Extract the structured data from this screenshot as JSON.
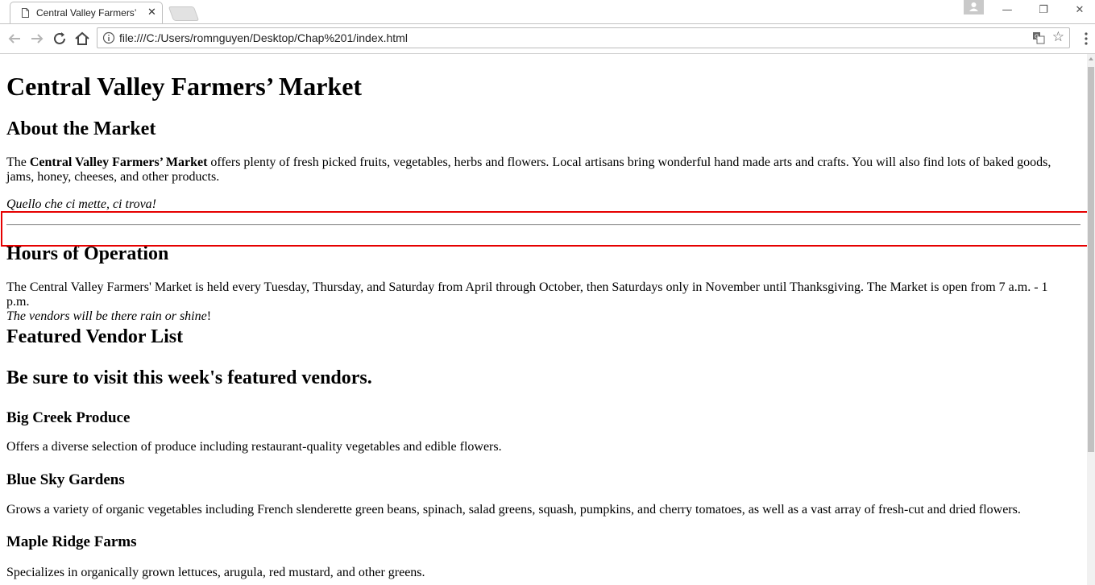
{
  "browser": {
    "tab_title": "Central Valley Farmers’ M",
    "url": "file:///C:/Users/romnguyen/Desktop/Chap%201/index.html",
    "close_glyph": "✕",
    "minimize_glyph": "—",
    "restore_glyph": "❐",
    "window_close_glyph": "✕"
  },
  "page": {
    "title": "Central Valley Farmers’ Market",
    "about": {
      "heading": "About the Market",
      "para_prefix": "The ",
      "para_bold": "Central Valley Farmers’ Market",
      "para_rest_line1": " offers plenty of fresh picked fruits, vegetables, herbs and flowers. Local artisans bring wonderful hand made arts and crafts. You will also find lots of baked goods,",
      "para_line2": "jams, honey, cheeses, and other products.",
      "motto": "Quello che ci mette, ci trova!"
    },
    "hours": {
      "heading": "Hours of Operation",
      "para_line1": "The Central Valley Farmers' Market is held every Tuesday, Thursday, and Saturday from April through October, then Saturdays only in November until Thanksgiving. The Market is open from 7 a.m. - 1 p.m.",
      "para_italic": "The vendors will be there rain or shine",
      "para_end": "!"
    },
    "vendors": {
      "heading": "Featured Vendor List",
      "subheading": "Be sure to visit this week's featured vendors.",
      "items": [
        {
          "name": "Big Creek Produce",
          "desc": "Offers a diverse selection of produce including restaurant-quality vegetables and edible flowers."
        },
        {
          "name": "Blue Sky Gardens",
          "desc": "Grows a variety of organic vegetables including French slenderette green beans, spinach, salad greens, squash, pumpkins, and cherry tomatoes, as well as a vast array of fresh-cut and dried flowers."
        },
        {
          "name": "Maple Ridge Farms",
          "desc": "Specializes in organically grown lettuces, arugula, red mustard, and other greens."
        }
      ]
    }
  },
  "colors": {
    "highlight_border": "#e60000"
  }
}
